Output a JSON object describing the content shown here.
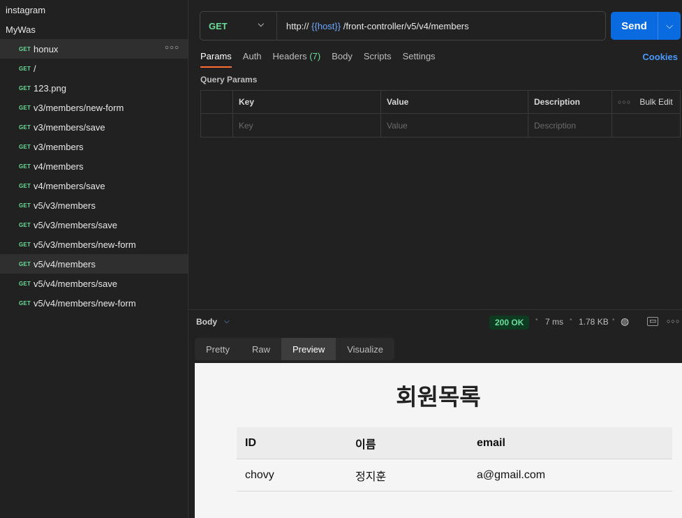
{
  "sidebar": {
    "collections": [
      "instagram",
      "MyWas"
    ],
    "requests": [
      {
        "method": "GET",
        "name": "honux"
      },
      {
        "method": "GET",
        "name": "/"
      },
      {
        "method": "GET",
        "name": "123.png"
      },
      {
        "method": "GET",
        "name": "v3/members/new-form"
      },
      {
        "method": "GET",
        "name": "v3/members/save"
      },
      {
        "method": "GET",
        "name": "v3/members"
      },
      {
        "method": "GET",
        "name": "v4/members"
      },
      {
        "method": "GET",
        "name": "v4/members/save"
      },
      {
        "method": "GET",
        "name": "v5/v3/members"
      },
      {
        "method": "GET",
        "name": "v5/v3/members/save"
      },
      {
        "method": "GET",
        "name": "v5/v3/members/new-form"
      },
      {
        "method": "GET",
        "name": "v5/v4/members"
      },
      {
        "method": "GET",
        "name": "v5/v4/members/save"
      },
      {
        "method": "GET",
        "name": "v5/v4/members/new-form"
      }
    ],
    "more_icon": "more-horizontal-icon"
  },
  "request": {
    "method": "GET",
    "url_prefix": "http://",
    "url_var": "{{host}}",
    "url_suffix": "/front-controller/v5/v4/members",
    "send_label": "Send"
  },
  "tabs": {
    "params": "Params",
    "auth": "Auth",
    "headers": "Headers",
    "headers_count": "(7)",
    "body": "Body",
    "scripts": "Scripts",
    "settings": "Settings",
    "cookies": "Cookies"
  },
  "query_params": {
    "title": "Query Params",
    "headers": {
      "key": "Key",
      "value": "Value",
      "description": "Description",
      "bulk_edit": "Bulk Edit"
    },
    "placeholders": {
      "key": "Key",
      "value": "Value",
      "description": "Description"
    }
  },
  "response": {
    "body_label": "Body",
    "status": "200 OK",
    "time": "7 ms",
    "size": "1.78 KB",
    "view_tabs": [
      "Pretty",
      "Raw",
      "Preview",
      "Visualize"
    ],
    "active_view": "Preview"
  },
  "preview": {
    "title": "회원목록",
    "columns": [
      "ID",
      "이름",
      "email"
    ],
    "rows": [
      [
        "chovy",
        "정지훈",
        "a@gmail.com"
      ]
    ]
  },
  "colors": {
    "get_method": "#6bdd9a",
    "send_button": "#0a6be0",
    "active_tab_underline": "#ff6c37",
    "link": "#4a9bff"
  }
}
